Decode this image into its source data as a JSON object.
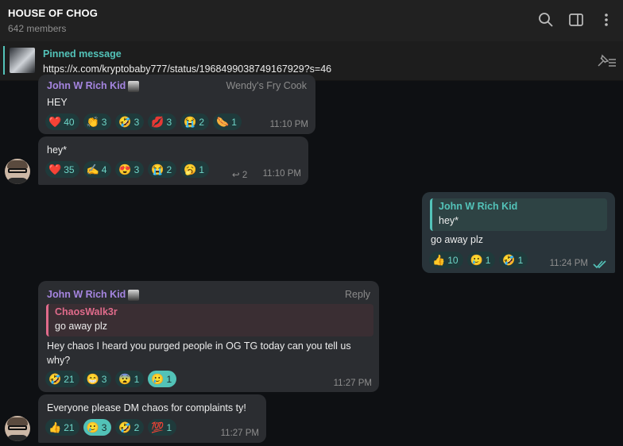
{
  "header": {
    "title": "HOUSE OF CHOG",
    "members": "642 members"
  },
  "pinned": {
    "title": "Pinned message",
    "text": "https://x.com/kryptobaby777/status/1968499038749167929?s=46"
  },
  "colors": {
    "accent": "#53c3b9",
    "sender_purple": "#a585e0",
    "quote_pink": "#e06b8b"
  },
  "messages": [
    {
      "sender": "John W Rich Kid",
      "tag": "Wendy's Fry Cook",
      "text": "HEY",
      "time": "11:10 PM",
      "reactions": [
        {
          "emoji": "❤️",
          "count": "40"
        },
        {
          "emoji": "👏",
          "count": "3"
        },
        {
          "emoji": "🤣",
          "count": "3"
        },
        {
          "emoji": "💋",
          "count": "3"
        },
        {
          "emoji": "😭",
          "count": "2"
        },
        {
          "emoji": "🌭",
          "count": "1"
        }
      ]
    },
    {
      "text": "hey*",
      "time": "11:10 PM",
      "replies": "2",
      "reactions": [
        {
          "emoji": "❤️",
          "count": "35"
        },
        {
          "emoji": "✍️",
          "count": "4"
        },
        {
          "emoji": "😍",
          "count": "3"
        },
        {
          "emoji": "😭",
          "count": "2"
        },
        {
          "emoji": "🥱",
          "count": "1"
        }
      ]
    },
    {
      "quote_name": "John W Rich Kid",
      "quote_text": "hey*",
      "text": "go away plz",
      "time": "11:24 PM",
      "reactions": [
        {
          "emoji": "👍",
          "count": "10"
        },
        {
          "emoji": "🥲",
          "count": "1"
        },
        {
          "emoji": "🤣",
          "count": "1"
        }
      ]
    },
    {
      "sender": "John W Rich Kid",
      "tag": "Reply",
      "quote_name": "ChaosWalk3r",
      "quote_text": "go away plz",
      "text_line1": "Hey chaos I heard you purged people in OG TG today can you tell us",
      "text_line2": "why?",
      "time": "11:27 PM",
      "reactions": [
        {
          "emoji": "🤣",
          "count": "21"
        },
        {
          "emoji": "😁",
          "count": "3"
        },
        {
          "emoji": "😨",
          "count": "1"
        },
        {
          "emoji": "🥲",
          "count": "1"
        }
      ]
    },
    {
      "text": "Everyone please DM chaos for complaints ty!",
      "time": "11:27 PM",
      "reactions": [
        {
          "emoji": "👍",
          "count": "21"
        },
        {
          "emoji": "🥲",
          "count": "3"
        },
        {
          "emoji": "🤣",
          "count": "2"
        },
        {
          "emoji": "💯",
          "count": "1"
        }
      ]
    }
  ]
}
